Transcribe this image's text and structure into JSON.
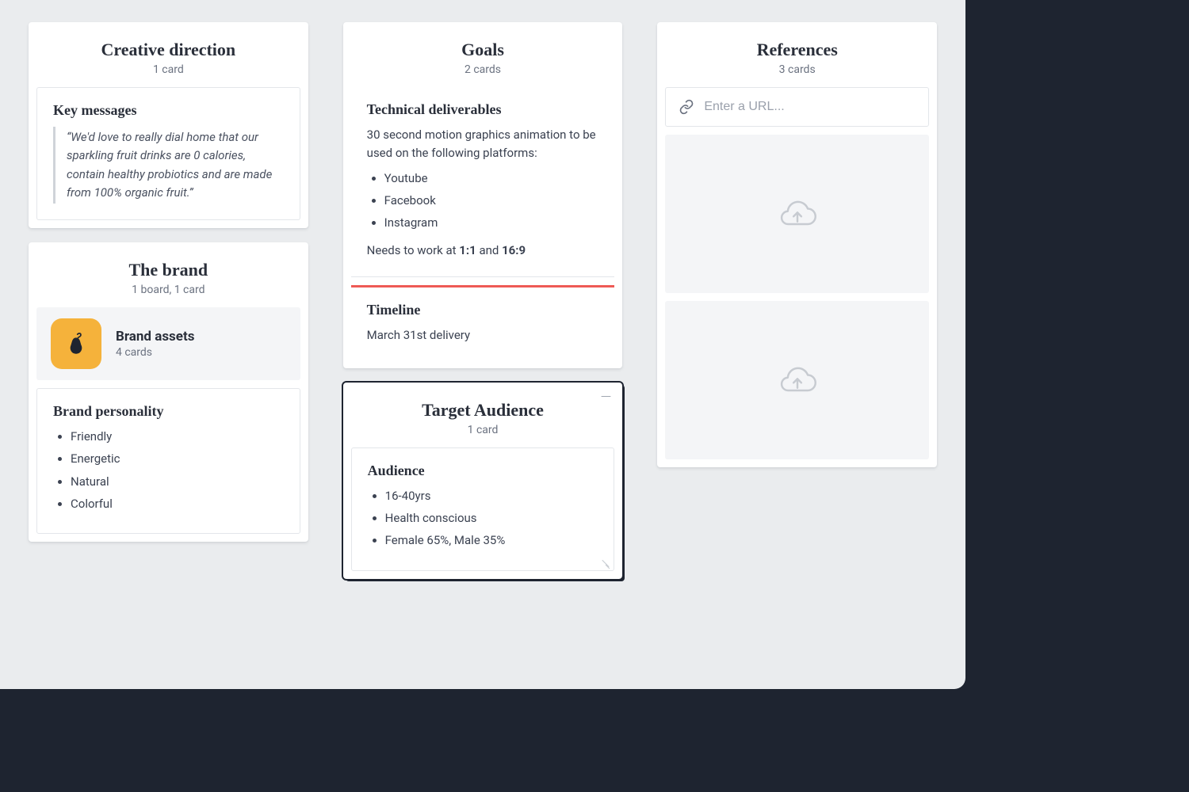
{
  "columns": {
    "creative": {
      "title": "Creative direction",
      "sub": "1 card",
      "key_messages": {
        "title": "Key messages",
        "quote": "“We'd love to really dial home that our sparkling fruit drinks are 0 calories, contain healthy probiotics and are made from 100% organic fruit.”"
      }
    },
    "brand": {
      "title": "The brand",
      "sub": "1 board, 1 card",
      "board": {
        "name": "Brand assets",
        "sub": "4 cards",
        "icon": "pear-icon"
      },
      "personality": {
        "title": "Brand personality",
        "items": [
          "Friendly",
          "Energetic",
          "Natural",
          "Colorful"
        ]
      }
    },
    "goals": {
      "title": "Goals",
      "sub": "2 cards",
      "tech": {
        "title": "Technical deliverables",
        "lead": "30 second motion graphics animation to be used on the following platforms:",
        "items": [
          "Youtube",
          "Facebook",
          "Instagram"
        ],
        "tail_pre": "Needs to work at ",
        "ratio1": "1:1",
        "tail_mid": " and ",
        "ratio2": "16:9"
      },
      "timeline": {
        "title": "Timeline",
        "text": "March 31st delivery"
      }
    },
    "audience": {
      "title": "Target Audience",
      "sub": "1 card",
      "card": {
        "title": "Audience",
        "items": [
          "16-40yrs",
          "Health conscious",
          "Female 65%, Male 35%"
        ]
      }
    },
    "references": {
      "title": "References",
      "sub": "3 cards",
      "url_placeholder": "Enter a URL..."
    }
  }
}
